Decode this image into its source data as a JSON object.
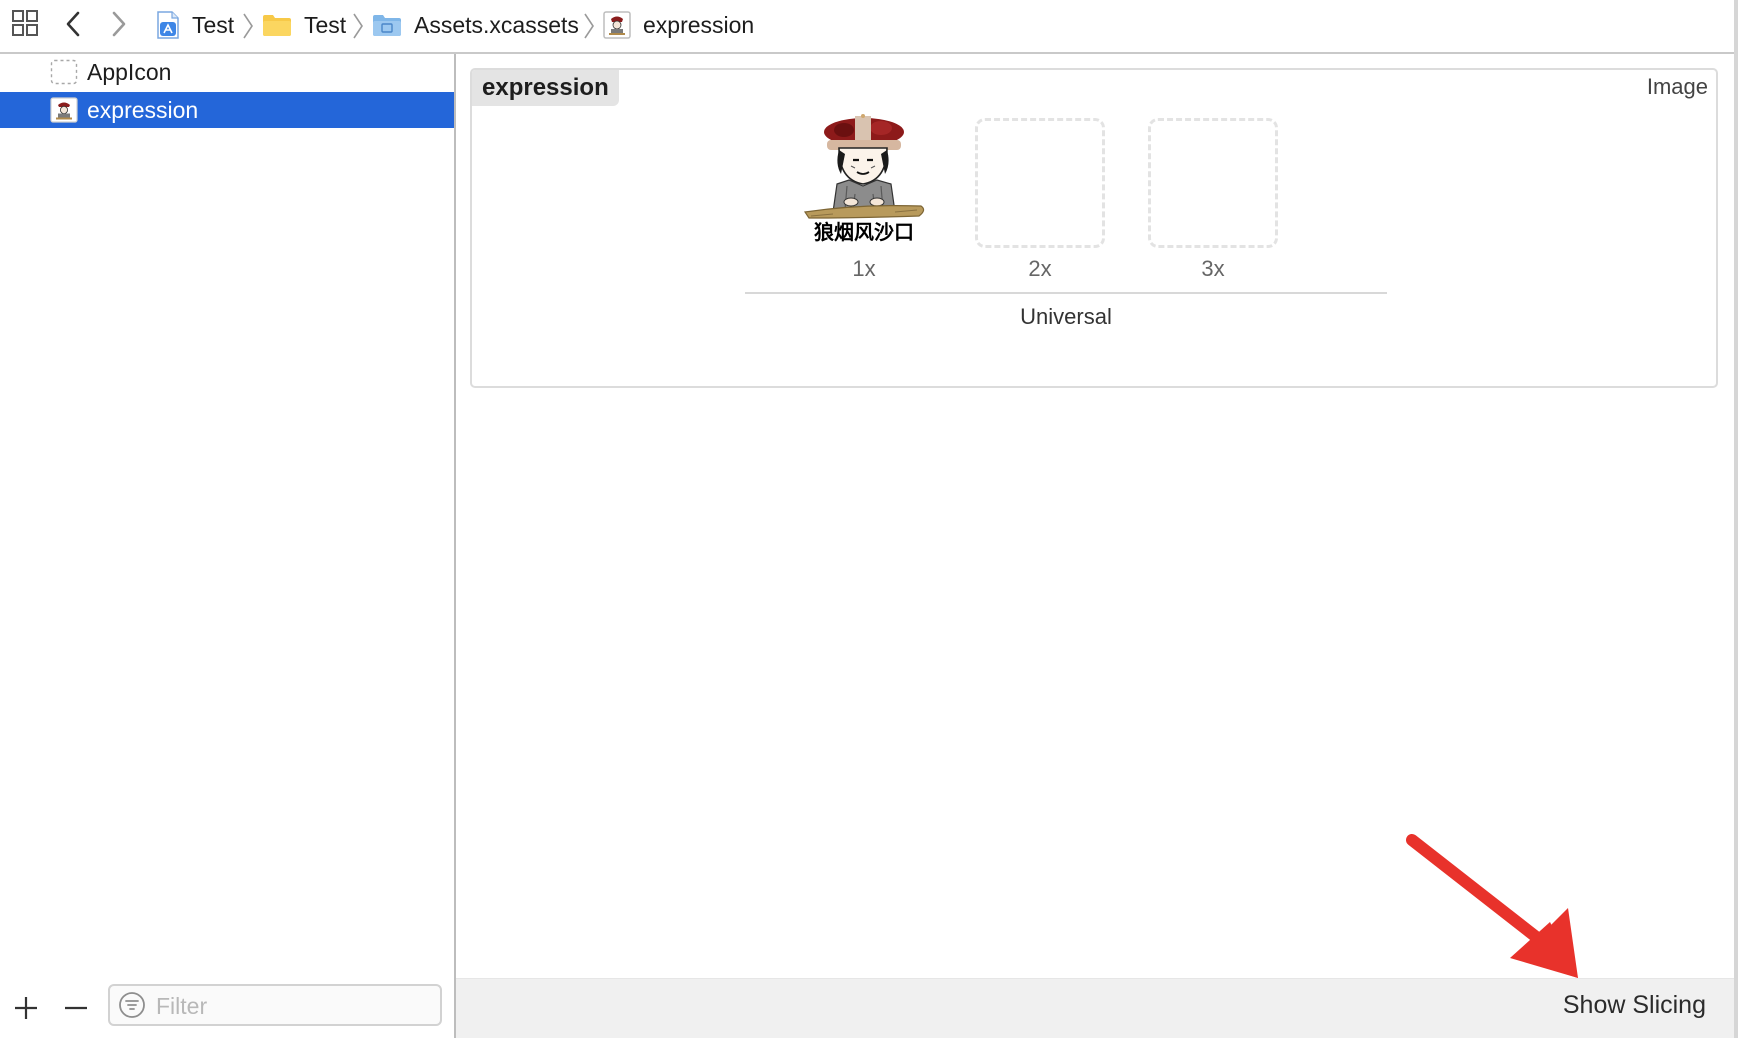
{
  "jumpbar": {
    "grid_icon": "related-items-grid-icon",
    "back_icon": "chevron-left-icon",
    "forward_icon": "chevron-right-icon",
    "breadcrumbs": [
      {
        "label": "Test",
        "icon": "app-project-icon"
      },
      {
        "label": "Test",
        "icon": "yellow-folder-icon"
      },
      {
        "label": "Assets.xcassets",
        "icon": "asset-catalog-folder-icon"
      },
      {
        "label": "expression",
        "icon": "image-asset-thumbnail-icon"
      }
    ]
  },
  "navigator": {
    "items": [
      {
        "label": "AppIcon",
        "icon": "dashed-appicon-placeholder-icon",
        "selected": false
      },
      {
        "label": "expression",
        "icon": "image-asset-thumbnail-icon",
        "selected": true
      }
    ],
    "add_icon": "plus-icon",
    "remove_icon": "minus-icon",
    "filter": {
      "placeholder": "Filter",
      "value": "",
      "icon": "filter-icon"
    },
    "selection_color": "#2466d9"
  },
  "editor": {
    "asset_name": "expression",
    "asset_kind": "Image",
    "slots": [
      {
        "label": "1x",
        "filled": true,
        "image_caption": "狼烟风沙口"
      },
      {
        "label": "2x",
        "filled": false
      },
      {
        "label": "3x",
        "filled": false
      }
    ],
    "idiom": "Universal",
    "show_slicing_label": "Show Slicing"
  },
  "annotation": {
    "color": "#e8322b",
    "icon": "red-arrow-icon"
  }
}
